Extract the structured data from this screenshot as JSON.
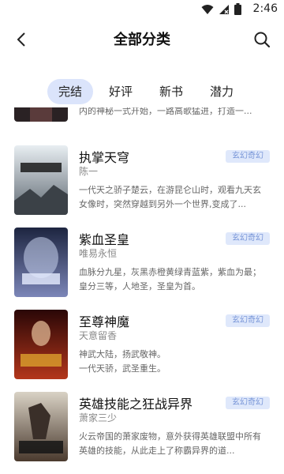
{
  "status": {
    "time": "2:46"
  },
  "header": {
    "title": "全部分类"
  },
  "tabs": [
    {
      "label": "完结",
      "active": true
    },
    {
      "label": "好评",
      "active": false
    },
    {
      "label": "新书",
      "active": false
    },
    {
      "label": "潜力",
      "active": false
    }
  ],
  "books": [
    {
      "title": "",
      "author": "",
      "tag": "",
      "desc": "内的神秘一式开始，一路高歌猛进，打造一..."
    },
    {
      "title": "执掌天穹",
      "author": "陈一",
      "tag": "玄幻奇幻",
      "desc": "一代天之骄子楚云，在游昆仑山时，观看九天玄女像时，突然穿越到另外一个世界,变成了..."
    },
    {
      "title": "紫血圣皇",
      "author": "唯易永恒",
      "tag": "玄幻奇幻",
      "desc": "血脉分九星，灰黑赤橙黄绿青蓝紫，紫血为最；皇分三等，人地圣，圣皇为首。"
    },
    {
      "title": "至尊神魔",
      "author": "天意留香",
      "tag": "玄幻奇幻",
      "desc": "神武大陆，扬武敬神。\n        一代天骄，武圣重生。"
    },
    {
      "title": "英雄技能之狂战异界",
      "author": "萧家三少",
      "tag": "玄幻奇幻",
      "desc": "火云帝国的萧家废物，意外获得英雄联盟中所有英雄的技能，从此走上了称霸异界的道..."
    }
  ],
  "colors": {
    "accent_tab": "#dbe4fb",
    "tag_bg": "#dfe8fb",
    "tag_text": "#7a97d8"
  }
}
